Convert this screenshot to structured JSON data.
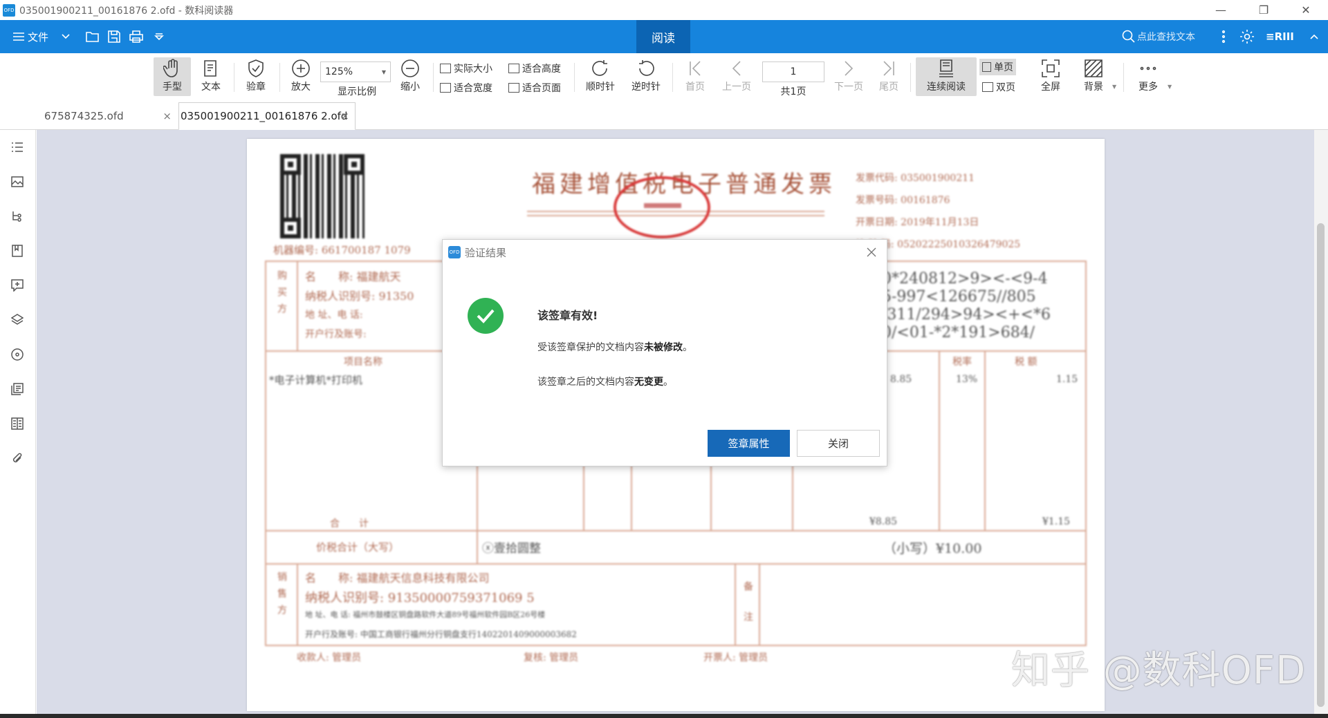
{
  "window": {
    "title": "035001900211_00161876 2.ofd - 数科阅读器",
    "app_icon_text": "OFD",
    "controls": {
      "minimize": "—",
      "restore": "❐",
      "close": "✕"
    }
  },
  "menubar": {
    "file_label": "文件",
    "active_tab": "阅读",
    "search_placeholder": "点此查找文本",
    "brand": "≡RIII"
  },
  "toolbar": {
    "hand": "手型",
    "text": "文本",
    "verify": "验章",
    "zoom_in": "放大",
    "zoom_value": "125%",
    "display_ratio": "显示比例",
    "zoom_out": "缩小",
    "actual_size": "实际大小",
    "fit_width": "适合宽度",
    "fit_height": "适合高度",
    "fit_page": "适合页面",
    "rotate_cw": "顺时针",
    "rotate_ccw": "逆时针",
    "first_page": "首页",
    "prev_page": "上一页",
    "page_number": "1",
    "page_total": "共1页",
    "next_page": "下一页",
    "last_page": "尾页",
    "continuous": "连续阅读",
    "single_page": "单页",
    "double_page": "双页",
    "fullscreen": "全屏",
    "background": "背景",
    "more": "更多"
  },
  "tabs": [
    {
      "label": "675874325.ofd",
      "close": "×"
    },
    {
      "label": "035001900211_00161876 2.ofd",
      "close": "×"
    }
  ],
  "invoice": {
    "title": "福建增值税电子普通发票",
    "field_code": "发票代码: 035001900211",
    "field_number": "发票号码: 00161876",
    "field_date": "开票日期: 2019年11月13日",
    "field_check": "校 验 码: 05202225010326479025",
    "machine_no": "机器编号: 661700187 1079",
    "buyer_label": "购买方",
    "buyer_name": "名　　称: 福建航天",
    "buyer_taxid": "纳税人识别号: 91350",
    "buyer_addr": "地 址、电 话:",
    "buyer_bank": "开户行及账号:",
    "cipher_1": "0*240812>9><-<9-4",
    "cipher_2": "5-997<126675//805",
    "cipher_3": "/311/294>94><+<*6",
    "cipher_4": "0/<01-*2*191>684/",
    "item_header": "项目名称",
    "item_name": "*电子计算机*打印机",
    "rate_header": "税率",
    "tax_header": "税 额",
    "item_amount": "8.85",
    "item_rate": "13%",
    "item_tax": "1.15",
    "total_label": "合　　计",
    "total_amount": "¥8.85",
    "total_tax": "¥1.15",
    "grand_label": "价税合计（大写）",
    "grand_words": "ⓧ壹拾圆整",
    "grand_small": "（小写）¥10.00",
    "seller_label": "销售方",
    "seller_name": "名　　称: 福建航天信息科技有限公司",
    "seller_taxid": "纳税人识别号: 91350000759371069 5",
    "seller_addr": "地 址、电 话: 福州市鼓楼区铜盘路软件大道89号福州软件园B区26号楼",
    "seller_bank": "开户行及账号: 中国工商银行福州分行铜盘支行1402201409000003682",
    "remark_label": "备注",
    "payee": "收款人: 管理员",
    "reviewer": "复核: 管理员",
    "drawer": "开票人: 管理员"
  },
  "dialog": {
    "title": "验证结果",
    "icon_text": "OFD",
    "headline": "该签章有效!",
    "line1_prefix": "受该签章保护的文档内容",
    "line1_bold": "未被修改",
    "line1_suffix": "。",
    "line2_prefix": "该签章之后的文档内容",
    "line2_bold": "无变更",
    "line2_suffix": "。",
    "primary_button": "签章属性",
    "close_button": "关闭"
  },
  "watermark": "知乎 @数科OFD",
  "colors": {
    "menubar_blue": "#1684dd",
    "active_tab": "#0c64b3",
    "success_green": "#30b254",
    "primary_button": "#1769b8",
    "doc_background": "#d9dce8"
  }
}
